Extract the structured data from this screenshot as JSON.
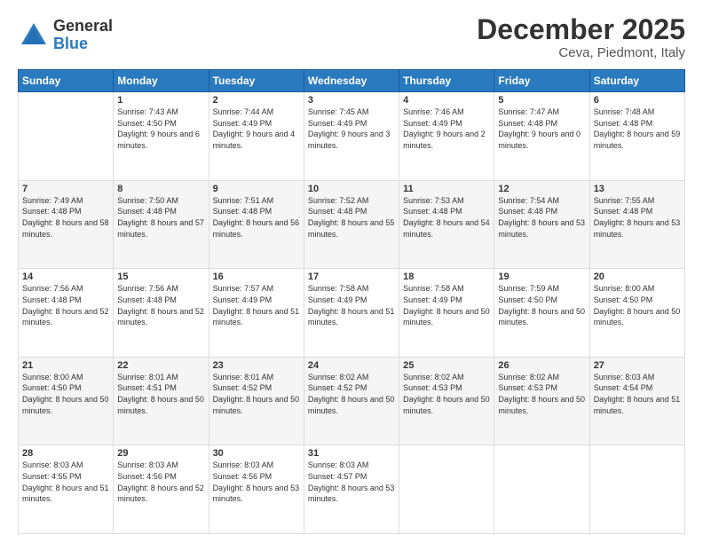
{
  "logo": {
    "general": "General",
    "blue": "Blue"
  },
  "header": {
    "month": "December 2025",
    "location": "Ceva, Piedmont, Italy"
  },
  "days": [
    "Sunday",
    "Monday",
    "Tuesday",
    "Wednesday",
    "Thursday",
    "Friday",
    "Saturday"
  ],
  "weeks": [
    [
      {
        "num": "",
        "sunrise": "",
        "sunset": "",
        "daylight": ""
      },
      {
        "num": "1",
        "sunrise": "Sunrise: 7:43 AM",
        "sunset": "Sunset: 4:50 PM",
        "daylight": "Daylight: 9 hours and 6 minutes."
      },
      {
        "num": "2",
        "sunrise": "Sunrise: 7:44 AM",
        "sunset": "Sunset: 4:49 PM",
        "daylight": "Daylight: 9 hours and 4 minutes."
      },
      {
        "num": "3",
        "sunrise": "Sunrise: 7:45 AM",
        "sunset": "Sunset: 4:49 PM",
        "daylight": "Daylight: 9 hours and 3 minutes."
      },
      {
        "num": "4",
        "sunrise": "Sunrise: 7:46 AM",
        "sunset": "Sunset: 4:49 PM",
        "daylight": "Daylight: 9 hours and 2 minutes."
      },
      {
        "num": "5",
        "sunrise": "Sunrise: 7:47 AM",
        "sunset": "Sunset: 4:48 PM",
        "daylight": "Daylight: 9 hours and 0 minutes."
      },
      {
        "num": "6",
        "sunrise": "Sunrise: 7:48 AM",
        "sunset": "Sunset: 4:48 PM",
        "daylight": "Daylight: 8 hours and 59 minutes."
      }
    ],
    [
      {
        "num": "7",
        "sunrise": "Sunrise: 7:49 AM",
        "sunset": "Sunset: 4:48 PM",
        "daylight": "Daylight: 8 hours and 58 minutes."
      },
      {
        "num": "8",
        "sunrise": "Sunrise: 7:50 AM",
        "sunset": "Sunset: 4:48 PM",
        "daylight": "Daylight: 8 hours and 57 minutes."
      },
      {
        "num": "9",
        "sunrise": "Sunrise: 7:51 AM",
        "sunset": "Sunset: 4:48 PM",
        "daylight": "Daylight: 8 hours and 56 minutes."
      },
      {
        "num": "10",
        "sunrise": "Sunrise: 7:52 AM",
        "sunset": "Sunset: 4:48 PM",
        "daylight": "Daylight: 8 hours and 55 minutes."
      },
      {
        "num": "11",
        "sunrise": "Sunrise: 7:53 AM",
        "sunset": "Sunset: 4:48 PM",
        "daylight": "Daylight: 8 hours and 54 minutes."
      },
      {
        "num": "12",
        "sunrise": "Sunrise: 7:54 AM",
        "sunset": "Sunset: 4:48 PM",
        "daylight": "Daylight: 8 hours and 53 minutes."
      },
      {
        "num": "13",
        "sunrise": "Sunrise: 7:55 AM",
        "sunset": "Sunset: 4:48 PM",
        "daylight": "Daylight: 8 hours and 53 minutes."
      }
    ],
    [
      {
        "num": "14",
        "sunrise": "Sunrise: 7:56 AM",
        "sunset": "Sunset: 4:48 PM",
        "daylight": "Daylight: 8 hours and 52 minutes."
      },
      {
        "num": "15",
        "sunrise": "Sunrise: 7:56 AM",
        "sunset": "Sunset: 4:48 PM",
        "daylight": "Daylight: 8 hours and 52 minutes."
      },
      {
        "num": "16",
        "sunrise": "Sunrise: 7:57 AM",
        "sunset": "Sunset: 4:49 PM",
        "daylight": "Daylight: 8 hours and 51 minutes."
      },
      {
        "num": "17",
        "sunrise": "Sunrise: 7:58 AM",
        "sunset": "Sunset: 4:49 PM",
        "daylight": "Daylight: 8 hours and 51 minutes."
      },
      {
        "num": "18",
        "sunrise": "Sunrise: 7:58 AM",
        "sunset": "Sunset: 4:49 PM",
        "daylight": "Daylight: 8 hours and 50 minutes."
      },
      {
        "num": "19",
        "sunrise": "Sunrise: 7:59 AM",
        "sunset": "Sunset: 4:50 PM",
        "daylight": "Daylight: 8 hours and 50 minutes."
      },
      {
        "num": "20",
        "sunrise": "Sunrise: 8:00 AM",
        "sunset": "Sunset: 4:50 PM",
        "daylight": "Daylight: 8 hours and 50 minutes."
      }
    ],
    [
      {
        "num": "21",
        "sunrise": "Sunrise: 8:00 AM",
        "sunset": "Sunset: 4:50 PM",
        "daylight": "Daylight: 8 hours and 50 minutes."
      },
      {
        "num": "22",
        "sunrise": "Sunrise: 8:01 AM",
        "sunset": "Sunset: 4:51 PM",
        "daylight": "Daylight: 8 hours and 50 minutes."
      },
      {
        "num": "23",
        "sunrise": "Sunrise: 8:01 AM",
        "sunset": "Sunset: 4:52 PM",
        "daylight": "Daylight: 8 hours and 50 minutes."
      },
      {
        "num": "24",
        "sunrise": "Sunrise: 8:02 AM",
        "sunset": "Sunset: 4:52 PM",
        "daylight": "Daylight: 8 hours and 50 minutes."
      },
      {
        "num": "25",
        "sunrise": "Sunrise: 8:02 AM",
        "sunset": "Sunset: 4:53 PM",
        "daylight": "Daylight: 8 hours and 50 minutes."
      },
      {
        "num": "26",
        "sunrise": "Sunrise: 8:02 AM",
        "sunset": "Sunset: 4:53 PM",
        "daylight": "Daylight: 8 hours and 50 minutes."
      },
      {
        "num": "27",
        "sunrise": "Sunrise: 8:03 AM",
        "sunset": "Sunset: 4:54 PM",
        "daylight": "Daylight: 8 hours and 51 minutes."
      }
    ],
    [
      {
        "num": "28",
        "sunrise": "Sunrise: 8:03 AM",
        "sunset": "Sunset: 4:55 PM",
        "daylight": "Daylight: 8 hours and 51 minutes."
      },
      {
        "num": "29",
        "sunrise": "Sunrise: 8:03 AM",
        "sunset": "Sunset: 4:56 PM",
        "daylight": "Daylight: 8 hours and 52 minutes."
      },
      {
        "num": "30",
        "sunrise": "Sunrise: 8:03 AM",
        "sunset": "Sunset: 4:56 PM",
        "daylight": "Daylight: 8 hours and 53 minutes."
      },
      {
        "num": "31",
        "sunrise": "Sunrise: 8:03 AM",
        "sunset": "Sunset: 4:57 PM",
        "daylight": "Daylight: 8 hours and 53 minutes."
      },
      {
        "num": "",
        "sunrise": "",
        "sunset": "",
        "daylight": ""
      },
      {
        "num": "",
        "sunrise": "",
        "sunset": "",
        "daylight": ""
      },
      {
        "num": "",
        "sunrise": "",
        "sunset": "",
        "daylight": ""
      }
    ]
  ]
}
